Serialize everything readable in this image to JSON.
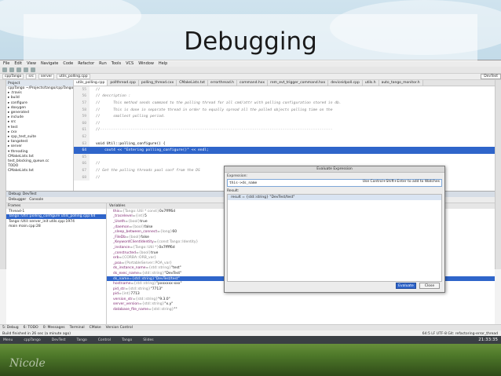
{
  "slide_title": "Debugging",
  "watermark": "Nicole",
  "menubar": [
    "File",
    "Edit",
    "View",
    "Navigate",
    "Code",
    "Refactor",
    "Run",
    "Tools",
    "VCS",
    "Window",
    "Help"
  ],
  "navbar": {
    "crumbs": [
      "cppTango",
      "src",
      "server",
      "utils_polling.cpp"
    ],
    "run_config": "DevTest"
  },
  "project": {
    "header": "Project",
    "tree": [
      "cppTango ~/Projects/tango/cppTango",
      "▸ .travis",
      "▸ build",
      "▸ configure",
      "▸ doxygen",
      "▸ generated",
      "▸ include",
      "▸ src",
      "▾ test",
      "  ▸ cxx",
      "  ▸ cpp_test_suite",
      "  ▸ tangotest",
      "  ▸ server",
      "  ▾ threading",
      "     CMakeLists.txt",
      "     test_blocking_queue.cc",
      "     TODO",
      "  CMakeLists.txt"
    ]
  },
  "tabs": [
    "utils_polling.cpp",
    "pollthread.cpp",
    "polling_thread.cxx",
    "CMakeLists.txt",
    "errorthread.h",
    "command.hxx",
    "rem_evt_trigger_command.hxx",
    "deviceidpoll.cpp",
    "utils.h",
    "auto_tango_monitor.h"
  ],
  "code_lines": [
    {
      "n": "55",
      "t": "//",
      "kind": "comment"
    },
    {
      "n": "56",
      "t": "// description :",
      "kind": "comment"
    },
    {
      "n": "57",
      "t": "//      This method sends command to the polling thread for all cmd/attr with polling configuration stored in db.",
      "kind": "comment"
    },
    {
      "n": "58",
      "t": "//      This is done in separate thread in order to equally spread all the polled objects polling time on the",
      "kind": "comment"
    },
    {
      "n": "59",
      "t": "//      smallest polling period.",
      "kind": "comment"
    },
    {
      "n": "60",
      "t": "//",
      "kind": "comment"
    },
    {
      "n": "61",
      "t": "//-----------------------------------------------------------------------------------------------------------",
      "kind": "comment"
    },
    {
      "n": "62",
      "t": "",
      "kind": "code"
    },
    {
      "n": "63",
      "t": "void Util::polling_configure() {",
      "kind": "code"
    },
    {
      "n": "64",
      "t": "    cout4 << \"Entering polling_configure()\" << endl;",
      "kind": "hl"
    },
    {
      "n": "65",
      "t": "",
      "kind": "code"
    },
    {
      "n": "66",
      "t": "//",
      "kind": "comment"
    },
    {
      "n": "67",
      "t": "// Get the polling threads pool conf from the DS",
      "kind": "comment"
    },
    {
      "n": "68",
      "t": "//",
      "kind": "comment"
    }
  ],
  "debug": {
    "title": "Debug: DevTest",
    "tabs": [
      "Debugger",
      "Console"
    ],
    "frames_header": "Frames",
    "frames": [
      "Thread-1",
      "Tango::Util::polling_configure utils_polling.cpp:64",
      "Tango::Util::server_init utils.cpp:1974",
      "main main.cpp:28"
    ],
    "vars_header": "Variables",
    "vars": [
      {
        "name": "this",
        "type": "{Tango::Util * const}",
        "val": "0x7ffff6d"
      },
      {
        "name": "_tracelevel",
        "type": "{int}",
        "val": "5"
      },
      {
        "name": "_Useth",
        "type": "{bool}",
        "val": "true"
      },
      {
        "name": "_daemon",
        "type": "{bool}",
        "val": "false"
      },
      {
        "name": "_sleep_between_connect",
        "type": "{long}",
        "val": "60"
      },
      {
        "name": "_FileDb",
        "type": "{bool}",
        "val": "false"
      },
      {
        "name": "_KeywordClientIdentity",
        "type": "{const Tango::Identity}",
        "val": ""
      },
      {
        "name": "_instance",
        "type": "{Tango::Util *}",
        "val": "0x7ffff6d"
      },
      {
        "name": "_constructed",
        "type": "{bool}",
        "val": "true"
      },
      {
        "name": "orb",
        "type": "{CORBA::ORB_var}",
        "val": ""
      },
      {
        "name": "_poa",
        "type": "{PortableServer::POA_var}",
        "val": ""
      },
      {
        "name": "ds_instance_name",
        "type": "{std::string}",
        "val": "\"test\""
      },
      {
        "name": "ds_exec_name",
        "type": "{std::string}",
        "val": "\"DevTest\""
      },
      {
        "name": "ds_name",
        "type": "{std::string}",
        "val": "\"DevTest/test\""
      },
      {
        "name": "hostname",
        "type": "{std::string}",
        "val": "\"pxxxxxx-xxx\""
      },
      {
        "name": "pid_str",
        "type": "{std::string}",
        "val": "\"7713\""
      },
      {
        "name": "pid",
        "type": "{int}",
        "val": "7713"
      },
      {
        "name": "version_str",
        "type": "{std::string}",
        "val": "\"9.3.0\""
      },
      {
        "name": "server_version",
        "type": "{std::string}",
        "val": "\"x.y\""
      },
      {
        "name": "database_file_name",
        "type": "{std::string}",
        "val": "\"\""
      }
    ]
  },
  "eval": {
    "title": "Evaluate Expression",
    "expr_label": "Expression:",
    "expr": "this->ds_name",
    "checkbox": "Use Control+Shift+Enter to add to Watches",
    "result_label": "Result:",
    "result": "result = {std::string} \"DevTest/test\"",
    "btn_eval": "Evaluate",
    "btn_close": "Close"
  },
  "bottom_tools": [
    "5: Debug",
    "6: TODO",
    "0: Messages",
    "Terminal",
    "CMake",
    "Version Control"
  ],
  "status_left": "Build finished in 26 sec (a minute ago)",
  "status_right": "64:5  LF  UTF-8  Git: refactoring-error_thread",
  "taskbar": [
    "Menu",
    "cppTango",
    "DevTest",
    "Tango",
    "Control",
    "Tango",
    "Slides"
  ],
  "clock": "21:33:35"
}
